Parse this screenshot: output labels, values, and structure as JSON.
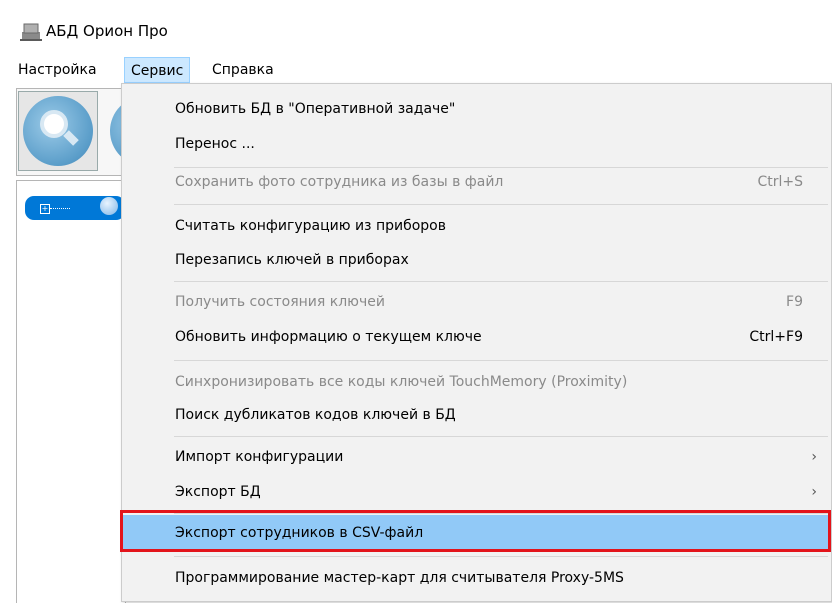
{
  "window": {
    "title": "АБД Орион Про",
    "icon": "app-icon"
  },
  "menubar": {
    "items": [
      {
        "label": "Настройка"
      },
      {
        "label": "Сервис"
      },
      {
        "label": "Справка"
      }
    ]
  },
  "colors": {
    "menu_active_bg": "#cce8ff",
    "highlight_bg": "#91c9f7",
    "highlight_border": "#e3141b",
    "tree_selected": "#0078d7"
  },
  "menu": {
    "items": [
      {
        "label": "Обновить БД в \"Оперативной задаче\"",
        "shortcut": "",
        "disabled": false
      },
      {
        "label": "Перенос ...",
        "shortcut": "",
        "disabled": false
      },
      {
        "label": "Сохранить фото сотрудника из базы в файл",
        "shortcut": "Ctrl+S",
        "disabled": true
      },
      {
        "label": "Считать конфигурацию из приборов",
        "shortcut": "",
        "disabled": false
      },
      {
        "label": "Перезапись ключей в приборах",
        "shortcut": "",
        "disabled": false
      },
      {
        "label": "Получить состояния ключей",
        "shortcut": "F9",
        "disabled": true
      },
      {
        "label": "Обновить информацию о текущем ключе",
        "shortcut": "Ctrl+F9",
        "disabled": false
      },
      {
        "label": "Синхронизировать все коды ключей TouchMemory (Proximity)",
        "shortcut": "",
        "disabled": true
      },
      {
        "label": "Поиск дубликатов кодов ключей в БД",
        "shortcut": "",
        "disabled": false
      },
      {
        "label": "Импорт конфигурации",
        "shortcut": "",
        "disabled": false,
        "submenu_arrow": "›"
      },
      {
        "label": "Экспорт БД",
        "shortcut": "",
        "disabled": false,
        "submenu_arrow": "›"
      },
      {
        "label": "Экспорт сотрудников в CSV-файл",
        "shortcut": "",
        "disabled": false,
        "highlighted": true
      },
      {
        "label": "Программирование мастер-карт для считывателя Proxy-5MS",
        "shortcut": "",
        "disabled": false
      }
    ]
  },
  "tree": {
    "expander": "+"
  }
}
